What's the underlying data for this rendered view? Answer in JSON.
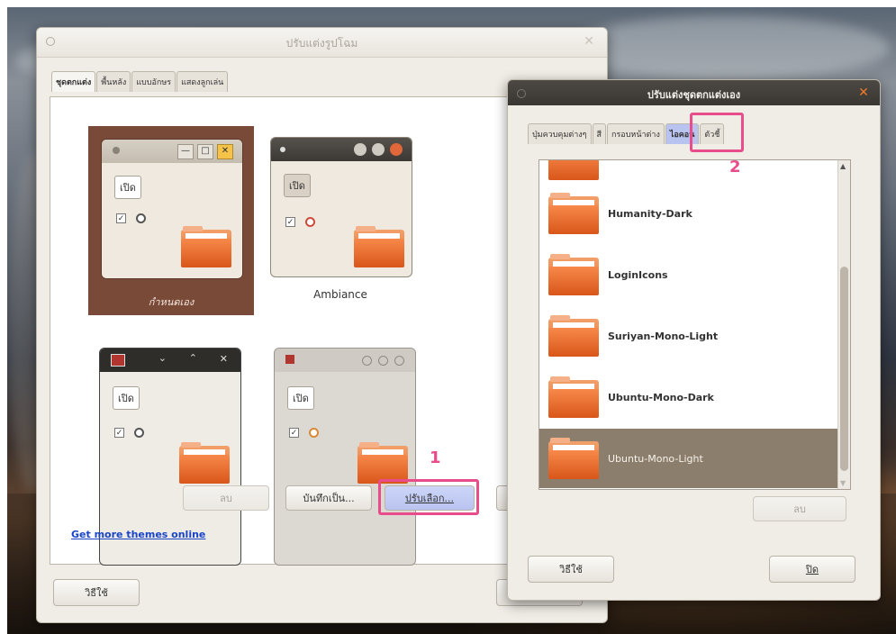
{
  "appearance": {
    "title": "ปรับแต่งรูปโฉม",
    "tabs": [
      "ชุดตกแต่ง",
      "พื้นหลัง",
      "แบบอักษร",
      "แสดงลูกเล่น"
    ],
    "themes": [
      {
        "name": "กำหนดเอง",
        "button": "เปิด"
      },
      {
        "name": "Ambiance",
        "button": "เปิด"
      },
      {
        "name": "",
        "button": "เปิด"
      },
      {
        "name": "",
        "button": "เปิด"
      }
    ],
    "buttons": {
      "delete": "ลบ",
      "save_as": "บันทึกเป็น...",
      "customize": "ปรับเลือก..."
    },
    "get_more_link": "Get more themes online",
    "help": "วิธีใช้"
  },
  "customize": {
    "title": "ปรับแต่งชุดตกแต่งเอง",
    "tabs": [
      "ปุ่มควบคุมต่างๆ",
      "สี",
      "กรอบหน้าต่าง",
      "ไอคอน",
      "ตัวชี้"
    ],
    "active_tab": "ไอคอน",
    "icon_themes": [
      "Humanity-Dark",
      "LoginIcons",
      "Suriyan-Mono-Light",
      "Ubuntu-Mono-Dark",
      "Ubuntu-Mono-Light"
    ],
    "selected_theme": "Ubuntu-Mono-Light",
    "buttons": {
      "delete": "ลบ",
      "help": "วิธีใช้",
      "close": "ปิด"
    }
  },
  "annotations": {
    "step1": "1",
    "step2": "2"
  },
  "colors": {
    "annotation": "#e84c8a",
    "selection": "#8c7e6c",
    "ubuntu_orange": "#f07a2a"
  }
}
